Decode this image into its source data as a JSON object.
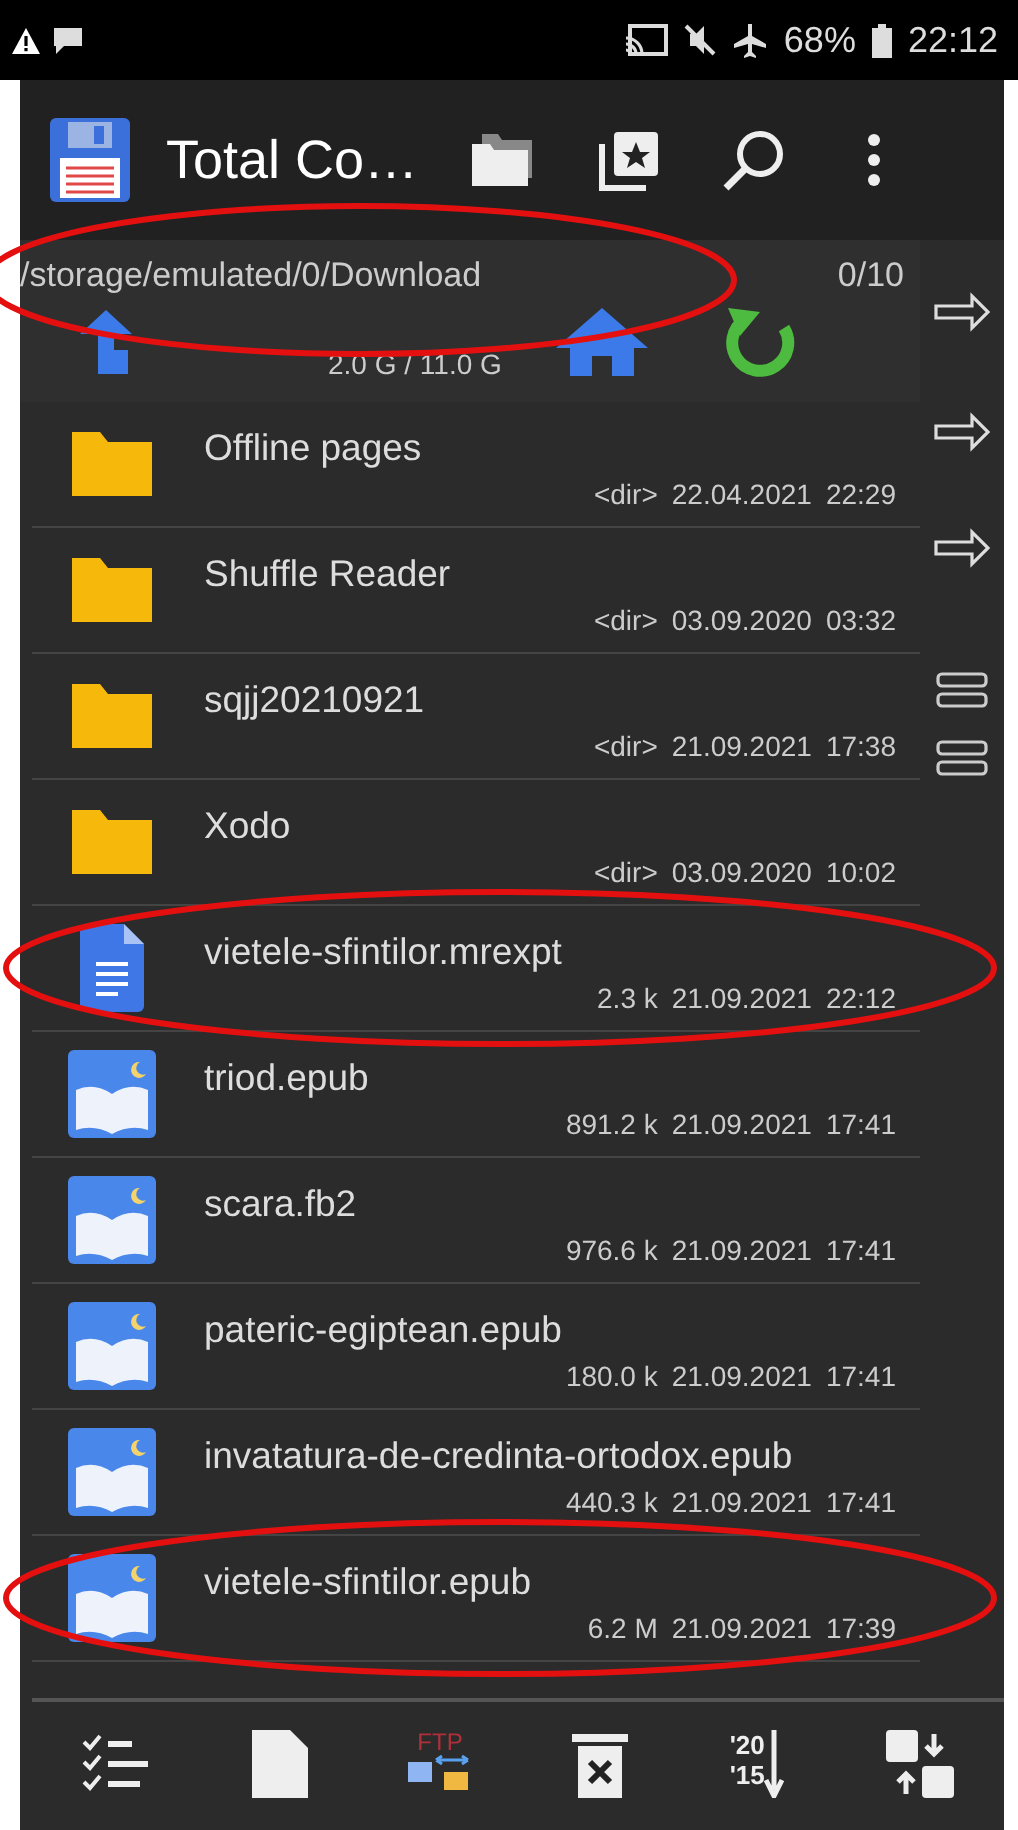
{
  "status_bar": {
    "battery": "68%",
    "time": "22:12"
  },
  "app_bar": {
    "title": "Total Co…"
  },
  "path_bar": {
    "path": "/storage/emulated/0/Download",
    "count": "0/10",
    "storage": "2.0 G / 11.0 G",
    "circled": true
  },
  "files": [
    {
      "kind": "folder",
      "name": "Offline pages",
      "size": "<dir>",
      "date": "22.04.2021",
      "time": "22:29",
      "circled": false
    },
    {
      "kind": "folder",
      "name": "Shuffle Reader",
      "size": "<dir>",
      "date": "03.09.2020",
      "time": "03:32",
      "circled": false
    },
    {
      "kind": "folder",
      "name": "sqjj20210921",
      "size": "<dir>",
      "date": "21.09.2021",
      "time": "17:38",
      "circled": false
    },
    {
      "kind": "folder",
      "name": "Xodo",
      "size": "<dir>",
      "date": "03.09.2020",
      "time": "10:02",
      "circled": false
    },
    {
      "kind": "document",
      "name": "vietele-sfintilor.mrexpt",
      "size": "2.3 k",
      "date": "21.09.2021",
      "time": "22:12",
      "circled": true
    },
    {
      "kind": "book",
      "name": "triod.epub",
      "size": "891.2 k",
      "date": "21.09.2021",
      "time": "17:41",
      "circled": false
    },
    {
      "kind": "book",
      "name": "scara.fb2",
      "size": "976.6 k",
      "date": "21.09.2021",
      "time": "17:41",
      "circled": false
    },
    {
      "kind": "book",
      "name": "pateric-egiptean.epub",
      "size": "180.0 k",
      "date": "21.09.2021",
      "time": "17:41",
      "circled": false
    },
    {
      "kind": "book",
      "name": "invatatura-de-credinta-ortodox.epub",
      "size": "440.3 k",
      "date": "21.09.2021",
      "time": "17:41",
      "circled": false
    },
    {
      "kind": "book",
      "name": "vietele-sfintilor.epub",
      "size": "6.2 M",
      "date": "21.09.2021",
      "time": "17:39",
      "circled": true
    }
  ],
  "side_buttons": [
    {
      "kind": "arrow"
    },
    {
      "kind": "arrow"
    },
    {
      "kind": "arrow"
    },
    {
      "kind": "equals"
    },
    {
      "kind": "equals"
    }
  ],
  "bottom_toolbar": [
    {
      "kind": "select"
    },
    {
      "kind": "new-file"
    },
    {
      "kind": "ftp",
      "label": "FTP"
    },
    {
      "kind": "delete"
    },
    {
      "kind": "sort",
      "top": "'20",
      "bottom": "'15"
    },
    {
      "kind": "swap"
    }
  ]
}
